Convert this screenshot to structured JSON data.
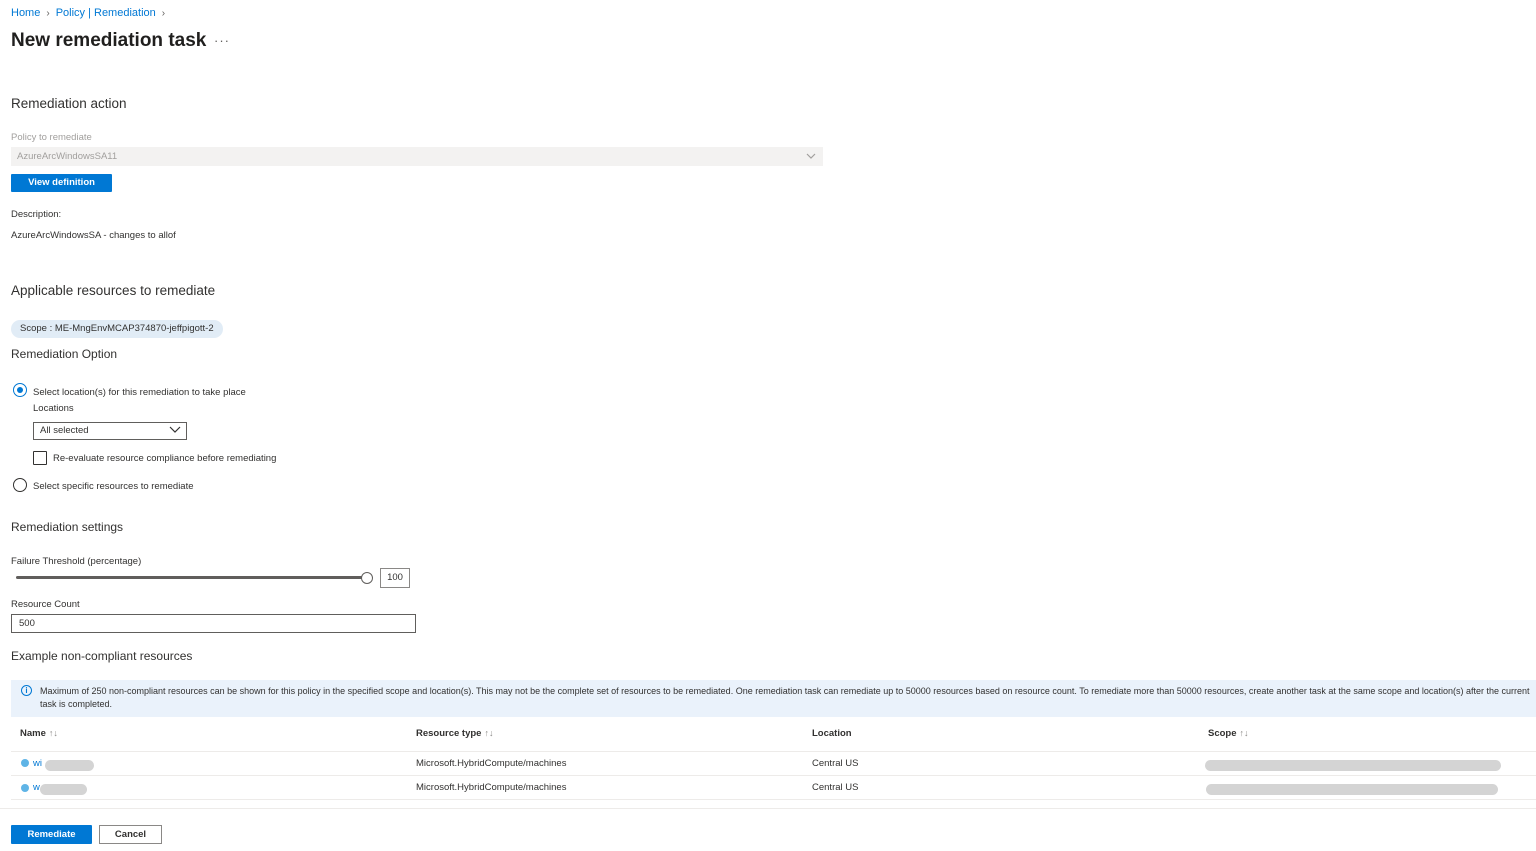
{
  "breadcrumb": {
    "home": "Home",
    "policy": "Policy | Remediation",
    "sep": ">"
  },
  "page": {
    "title": "New remediation task",
    "more": "···"
  },
  "remediation_action": {
    "heading": "Remediation action",
    "policy_label": "Policy to remediate",
    "policy_value": "AzureArcWindowsSA11",
    "view_definition": "View definition",
    "description_label": "Description:",
    "description_value": "AzureArcWindowsSA - changes to allof"
  },
  "applicable": {
    "heading": "Applicable resources to remediate",
    "scope": "Scope : ME-MngEnvMCAP374870-jeffpigott-2"
  },
  "option": {
    "heading": "Remediation Option",
    "radio_locations": "Select location(s) for this remediation to take place",
    "locations_label": "Locations",
    "locations_value": "All selected",
    "reevaluate": "Re-evaluate resource compliance before remediating",
    "radio_specific": "Select specific resources to remediate"
  },
  "settings": {
    "heading": "Remediation settings",
    "failure_label": "Failure Threshold (percentage)",
    "failure_value": "100",
    "count_label": "Resource Count",
    "count_value": "500"
  },
  "example": {
    "heading": "Example non-compliant resources",
    "info": "Maximum of 250 non-compliant resources can be shown for this policy in the specified scope and location(s). This may not be the complete set of resources to be remediated. One remediation task can remediate up to 50000 resources based on resource count. To remediate more than 50000 resources, create another task at the same scope and location(s) after the current task is completed.",
    "columns": [
      "Name",
      "Resource type",
      "Location",
      "Scope"
    ],
    "sort_glyph": "↑↓",
    "rows": [
      {
        "name": "wi",
        "type": "Microsoft.HybridCompute/machines",
        "location": "Central US"
      },
      {
        "name": "w",
        "type": "Microsoft.HybridCompute/machines",
        "location": "Central US"
      }
    ]
  },
  "footer": {
    "remediate": "Remediate",
    "cancel": "Cancel"
  }
}
